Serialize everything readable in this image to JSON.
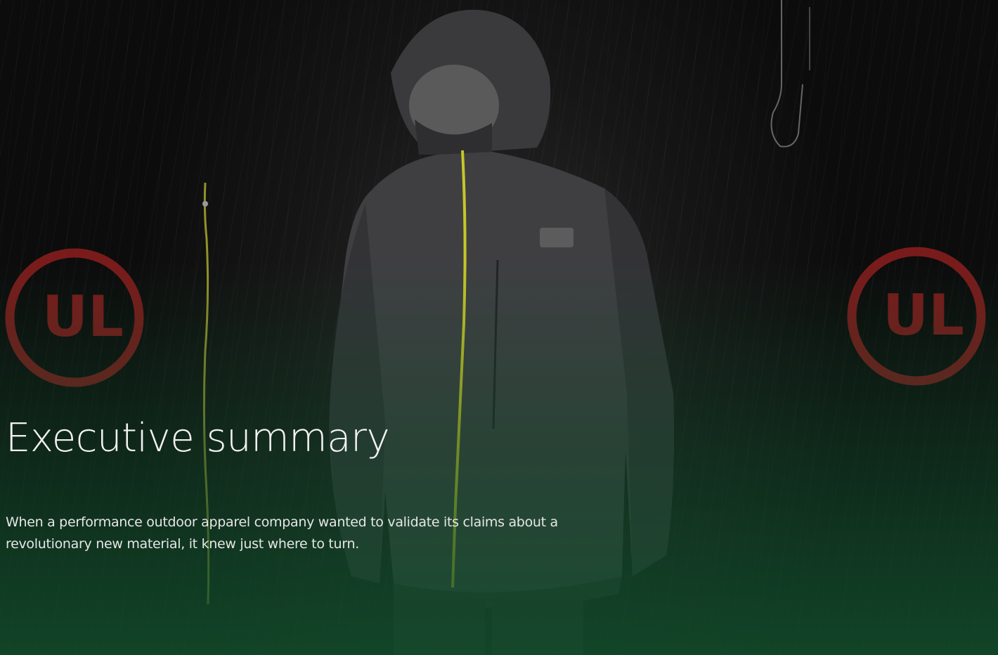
{
  "hero": {
    "title": "Executive summary",
    "description": "When a performance outdoor apparel company wanted to validate its claims about a revolutionary new material, it knew just where to turn.",
    "logo_text": "UL",
    "colors": {
      "logo_red": "#8e1e1e",
      "zipper_yellow": "#c7c628",
      "overlay_green": "#124e2c"
    },
    "icons": [
      "ul-logo-icon",
      "jacket-icon"
    ]
  }
}
